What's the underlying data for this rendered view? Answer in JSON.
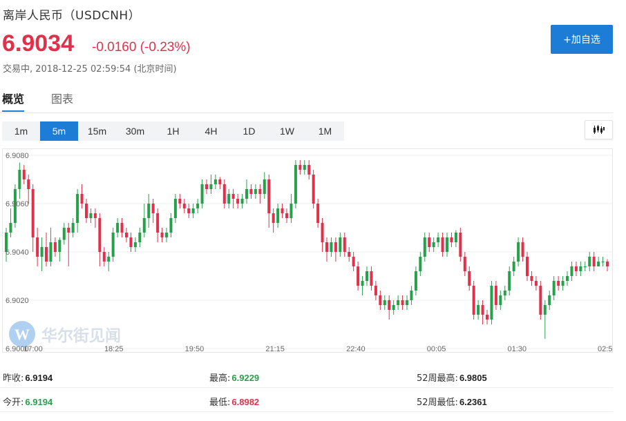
{
  "header": {
    "title": "离岸人民币（USDCNH）",
    "price": "6.9034",
    "change": "-0.0160 (-0.23%)",
    "status": "交易中, 2018-12-25 02:59:54 (北京时间)",
    "watch_button": "+加自选"
  },
  "tabs": [
    {
      "label": "概览",
      "active": true
    },
    {
      "label": "图表",
      "active": false
    }
  ],
  "periods": [
    "1m",
    "5m",
    "15m",
    "30m",
    "1H",
    "4H",
    "1D",
    "1W",
    "1M"
  ],
  "active_period": "5m",
  "watermark": "华尔街见闻",
  "colors": {
    "up": "#27a04a",
    "down": "#e0314b",
    "accent": "#1c7cd6"
  },
  "chart_data": {
    "type": "candlestick",
    "y_ticks": [
      "6.9080",
      "6.9060",
      "6.9040",
      "6.9020",
      "6.9000"
    ],
    "x_ticks": [
      "17:00",
      "18:25",
      "19:50",
      "21:15",
      "22:40",
      "00:05",
      "01:30",
      "02:5"
    ],
    "ylim": [
      6.9,
      6.908
    ],
    "grid": true,
    "candles": [
      [
        6.904,
        6.9048,
        6.9036,
        6.905
      ],
      [
        6.9048,
        6.9052,
        6.9046,
        6.9058
      ],
      [
        6.9052,
        6.9066,
        6.905,
        6.9068
      ],
      [
        6.9066,
        6.9074,
        6.9062,
        6.9077
      ],
      [
        6.9074,
        6.907,
        6.9068,
        6.9076
      ],
      [
        6.907,
        6.9066,
        6.906,
        6.9072
      ],
      [
        6.9066,
        6.9046,
        6.904,
        6.9068
      ],
      [
        6.9046,
        6.9038,
        6.9034,
        6.905
      ],
      [
        6.9038,
        6.9042,
        6.9032,
        6.9046
      ],
      [
        6.9042,
        6.9036,
        6.9034,
        6.9048
      ],
      [
        6.9036,
        6.9044,
        6.9034,
        6.905
      ],
      [
        6.9044,
        6.904,
        6.9038,
        6.9046
      ],
      [
        6.904,
        6.9045,
        6.9036,
        6.9046
      ],
      [
        6.9045,
        6.905,
        6.9043,
        6.9052
      ],
      [
        6.905,
        6.9048,
        6.9034,
        6.9052
      ],
      [
        6.9048,
        6.9052,
        6.9046,
        6.9054
      ],
      [
        6.9052,
        6.9064,
        6.9048,
        6.9066
      ],
      [
        6.9064,
        6.906,
        6.9058,
        6.9068
      ],
      [
        6.906,
        6.9054,
        6.9052,
        6.9062
      ],
      [
        6.9054,
        6.9056,
        6.9052,
        6.9058
      ],
      [
        6.9056,
        6.9054,
        6.905,
        6.9058
      ],
      [
        6.9054,
        6.904,
        6.9034,
        6.9056
      ],
      [
        6.904,
        6.9036,
        6.9034,
        6.9042
      ],
      [
        6.9036,
        6.9038,
        6.9032,
        6.904
      ],
      [
        6.9038,
        6.9048,
        6.9036,
        6.905
      ],
      [
        6.9048,
        6.9052,
        6.9046,
        6.9054
      ],
      [
        6.9052,
        6.9048,
        6.9046,
        6.9054
      ],
      [
        6.9048,
        6.9046,
        6.9044,
        6.905
      ],
      [
        6.9046,
        6.9042,
        6.904,
        6.9048
      ],
      [
        6.9042,
        6.9044,
        6.904,
        6.9046
      ],
      [
        6.9044,
        6.9048,
        6.9042,
        6.905
      ],
      [
        6.9048,
        6.9054,
        6.9046,
        6.906
      ],
      [
        6.9054,
        6.906,
        6.905,
        6.9064
      ],
      [
        6.906,
        6.9056,
        6.9052,
        6.9062
      ],
      [
        6.9056,
        6.9048,
        6.9044,
        6.9058
      ],
      [
        6.9048,
        6.9046,
        6.9044,
        6.905
      ],
      [
        6.9046,
        6.9048,
        6.9044,
        6.905
      ],
      [
        6.9048,
        6.9054,
        6.9046,
        6.9056
      ],
      [
        6.9054,
        6.9062,
        6.9052,
        6.9064
      ],
      [
        6.9062,
        6.906,
        6.9058,
        6.9064
      ],
      [
        6.906,
        6.9058,
        6.9056,
        6.9062
      ],
      [
        6.9058,
        6.9056,
        6.9054,
        6.906
      ],
      [
        6.9056,
        6.9058,
        6.9054,
        6.906
      ],
      [
        6.9058,
        6.906,
        6.9056,
        6.9062
      ],
      [
        6.906,
        6.9068,
        6.9058,
        6.907
      ],
      [
        6.9068,
        6.9066,
        6.9064,
        6.907
      ],
      [
        6.9066,
        6.9068,
        6.9064,
        6.9072
      ],
      [
        6.9068,
        6.907,
        6.9066,
        6.9072
      ],
      [
        6.907,
        6.9068,
        6.9066,
        6.9071
      ],
      [
        6.9068,
        6.906,
        6.9058,
        6.907
      ],
      [
        6.906,
        6.9064,
        6.9058,
        6.9066
      ],
      [
        6.9064,
        6.9062,
        6.9058,
        6.9066
      ],
      [
        6.9062,
        6.906,
        6.9058,
        6.9064
      ],
      [
        6.906,
        6.9062,
        6.9058,
        6.9064
      ],
      [
        6.9062,
        6.9066,
        6.906,
        6.907
      ],
      [
        6.9066,
        6.9064,
        6.9062,
        6.9068
      ],
      [
        6.9064,
        6.9066,
        6.9062,
        6.9068
      ],
      [
        6.9066,
        6.9064,
        6.906,
        6.9068
      ],
      [
        6.9064,
        6.907,
        6.9062,
        6.9073
      ],
      [
        6.907,
        6.9056,
        6.905,
        6.9072
      ],
      [
        6.9056,
        6.9052,
        6.9048,
        6.9058
      ],
      [
        6.9052,
        6.9058,
        6.905,
        6.906
      ],
      [
        6.9058,
        6.9056,
        6.9054,
        6.906
      ],
      [
        6.9056,
        6.9054,
        6.9052,
        6.9058
      ],
      [
        6.9054,
        6.906,
        6.9052,
        6.9064
      ],
      [
        6.906,
        6.9076,
        6.9058,
        6.9078
      ],
      [
        6.9076,
        6.9074,
        6.9072,
        6.9078
      ],
      [
        6.9074,
        6.9076,
        6.9072,
        6.9078
      ],
      [
        6.9076,
        6.9072,
        6.907,
        6.9078
      ],
      [
        6.9072,
        6.906,
        6.9058,
        6.9074
      ],
      [
        6.906,
        6.9052,
        6.905,
        6.9062
      ],
      [
        6.9052,
        6.9044,
        6.904,
        6.9054
      ],
      [
        6.9044,
        6.904,
        6.9036,
        6.9046
      ],
      [
        6.904,
        6.9044,
        6.9038,
        6.9046
      ],
      [
        6.9044,
        6.904,
        6.9036,
        6.9046
      ],
      [
        6.904,
        6.9046,
        6.9038,
        6.9048
      ],
      [
        6.9046,
        6.904,
        6.9038,
        6.9048
      ],
      [
        6.904,
        6.9038,
        6.9036,
        6.9042
      ],
      [
        6.9038,
        6.9034,
        6.9032,
        6.904
      ],
      [
        6.9034,
        6.9026,
        6.9024,
        6.9036
      ],
      [
        6.9026,
        6.9028,
        6.9022,
        6.903
      ],
      [
        6.9028,
        6.9032,
        6.9026,
        6.9034
      ],
      [
        6.9032,
        6.9026,
        6.9024,
        6.9034
      ],
      [
        6.9026,
        6.9022,
        6.902,
        6.9028
      ],
      [
        6.9022,
        6.9018,
        6.9016,
        6.9024
      ],
      [
        6.9018,
        6.902,
        6.9016,
        6.9022
      ],
      [
        6.902,
        6.9016,
        6.9012,
        6.9022
      ],
      [
        6.9016,
        6.9018,
        6.9014,
        6.902
      ],
      [
        6.9018,
        6.902,
        6.9016,
        6.9022
      ],
      [
        6.902,
        6.9018,
        6.9016,
        6.9022
      ],
      [
        6.9018,
        6.902,
        6.9016,
        6.9022
      ],
      [
        6.902,
        6.9024,
        6.9018,
        6.9026
      ],
      [
        6.9024,
        6.9032,
        6.9022,
        6.9034
      ],
      [
        6.9032,
        6.9038,
        6.903,
        6.904
      ],
      [
        6.9038,
        6.9046,
        6.9036,
        6.9048
      ],
      [
        6.9046,
        6.9042,
        6.904,
        6.9048
      ],
      [
        6.9042,
        6.9044,
        6.904,
        6.9046
      ],
      [
        6.9044,
        6.9046,
        6.9042,
        6.9048
      ],
      [
        6.9046,
        6.904,
        6.9038,
        6.9048
      ],
      [
        6.904,
        6.9046,
        6.9038,
        6.9048
      ],
      [
        6.9046,
        6.9044,
        6.9042,
        6.9048
      ],
      [
        6.9044,
        6.9048,
        6.9042,
        6.9049
      ],
      [
        6.9048,
        6.9038,
        6.9036,
        6.905
      ],
      [
        6.9038,
        6.9032,
        6.903,
        6.904
      ],
      [
        6.9032,
        6.9026,
        6.9024,
        6.9034
      ],
      [
        6.9026,
        6.9014,
        6.9012,
        6.9028
      ],
      [
        6.9014,
        6.9018,
        6.9012,
        6.902
      ],
      [
        6.9018,
        6.9014,
        6.901,
        6.902
      ],
      [
        6.9014,
        6.9012,
        6.901,
        6.9016
      ],
      [
        6.9012,
        6.9026,
        6.901,
        6.9028
      ],
      [
        6.9026,
        6.9018,
        6.9016,
        6.9028
      ],
      [
        6.9018,
        6.9022,
        6.9016,
        6.9024
      ],
      [
        6.9022,
        6.9024,
        6.902,
        6.9026
      ],
      [
        6.9024,
        6.9032,
        6.9022,
        6.9034
      ],
      [
        6.9032,
        6.9036,
        6.903,
        6.9038
      ],
      [
        6.9036,
        6.9044,
        6.9034,
        6.9046
      ],
      [
        6.9044,
        6.9038,
        6.9036,
        6.9046
      ],
      [
        6.9038,
        6.903,
        6.9028,
        6.904
      ],
      [
        6.903,
        6.9028,
        6.9026,
        6.9032
      ],
      [
        6.9028,
        6.9026,
        6.9024,
        6.903
      ],
      [
        6.9026,
        6.9014,
        6.9012,
        6.9028
      ],
      [
        6.9014,
        6.9018,
        6.9004,
        6.902
      ],
      [
        6.9018,
        6.9022,
        6.9016,
        6.9024
      ],
      [
        6.9022,
        6.9028,
        6.902,
        6.903
      ],
      [
        6.9028,
        6.9026,
        6.9024,
        6.903
      ],
      [
        6.9026,
        6.9028,
        6.9024,
        6.903
      ],
      [
        6.9028,
        6.903,
        6.9026,
        6.9032
      ],
      [
        6.903,
        6.9034,
        6.9028,
        6.9036
      ],
      [
        6.9034,
        6.9032,
        6.903,
        6.9036
      ],
      [
        6.9032,
        6.9034,
        6.903,
        6.9036
      ],
      [
        6.9034,
        6.9034,
        6.9032,
        6.9036
      ],
      [
        6.9034,
        6.9038,
        6.9032,
        6.904
      ],
      [
        6.9038,
        6.9034,
        6.9032,
        6.904
      ],
      [
        6.9034,
        6.9036,
        6.9034,
        6.9038
      ],
      [
        6.9036,
        6.9036,
        6.9034,
        6.9038
      ],
      [
        6.9036,
        6.9034,
        6.9032,
        6.9037
      ]
    ]
  },
  "stats": [
    [
      {
        "label": "昨收:",
        "value": "6.9194",
        "color": "#222"
      },
      {
        "label": "最高:",
        "value": "6.9229",
        "color": "#27a04a"
      },
      {
        "label": "52周最高:",
        "value": "6.9805",
        "color": "#222"
      }
    ],
    [
      {
        "label": "今开:",
        "value": "6.9194",
        "color": "#27a04a"
      },
      {
        "label": "最低:",
        "value": "6.8982",
        "color": "#e0314b"
      },
      {
        "label": "52周最低:",
        "value": "6.2361",
        "color": "#222"
      }
    ]
  ]
}
